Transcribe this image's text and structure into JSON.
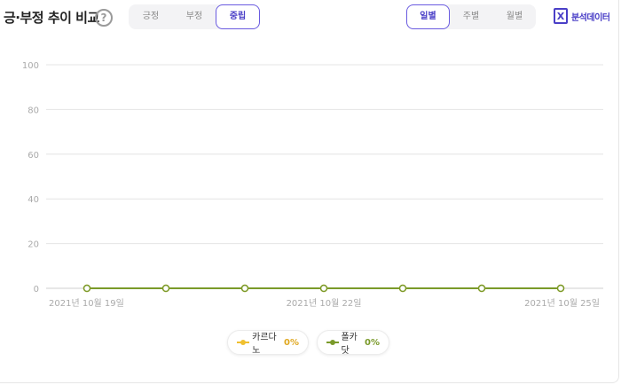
{
  "header": {
    "title": "긍·부정 추이 비교",
    "help_glyph": "?",
    "sentiment_tabs": [
      {
        "label": "긍정",
        "active": false
      },
      {
        "label": "부정",
        "active": false
      },
      {
        "label": "중립",
        "active": true
      }
    ],
    "period_tabs": [
      {
        "label": "일별",
        "active": true
      },
      {
        "label": "주별",
        "active": false
      },
      {
        "label": "월별",
        "active": false
      }
    ],
    "export_label": "분석데이터",
    "export_icon": "excel-icon"
  },
  "colors": {
    "accent": "#4a3fc7",
    "series_1": "#f0c030",
    "series_2": "#7a9a2a",
    "grid": "#e4e4e4",
    "axis_text": "#aaaaaa"
  },
  "chart_data": {
    "type": "line",
    "ylim": [
      0,
      100
    ],
    "yticks": [
      0,
      20,
      40,
      60,
      80,
      100
    ],
    "x": [
      "2021-10-19",
      "2021-10-20",
      "2021-10-21",
      "2021-10-22",
      "2021-10-23",
      "2021-10-24",
      "2021-10-25"
    ],
    "xtick_labels": [
      {
        "index": 0,
        "label": "2021년 10월 19일"
      },
      {
        "index": 3,
        "label": "2021년 10월 22일"
      },
      {
        "index": 6,
        "label": "2021년 10월 25일"
      }
    ],
    "series": [
      {
        "name": "카르다노",
        "values": [
          0,
          0,
          0,
          0,
          0,
          0,
          0
        ],
        "total": "0%"
      },
      {
        "name": "폴카닷",
        "values": [
          0,
          0,
          0,
          0,
          0,
          0,
          0
        ],
        "total": "0%"
      }
    ],
    "grid": true,
    "legend_position": "bottom-center"
  }
}
